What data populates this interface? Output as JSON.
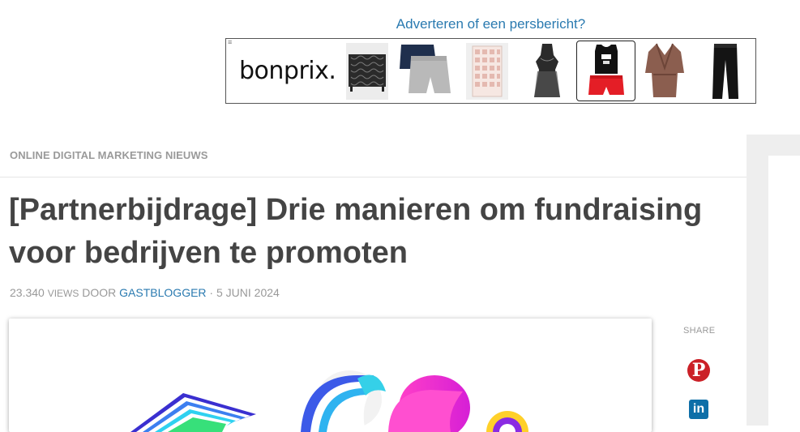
{
  "ad": {
    "link_text": "Adverteren of een persbericht?",
    "menu_icon": "menu-icon",
    "brand": "bonprix.",
    "products": [
      {
        "name": "black-cabinet"
      },
      {
        "name": "shorts"
      },
      {
        "name": "rack"
      },
      {
        "name": "lingerie"
      },
      {
        "name": "pajama-set"
      },
      {
        "name": "bathrobe"
      },
      {
        "name": "trousers"
      }
    ],
    "colors": {
      "link": "#2a7ab0"
    }
  },
  "article": {
    "category": "ONLINE DIGITAL MARKETING NIEUWS",
    "title": "[Partnerbijdrage] Drie manieren om fundraising voor bedrijven te promoten",
    "meta": {
      "views": "23.340",
      "views_label": "VIEWS",
      "by": "DOOR",
      "author": "GASTBLOGGER",
      "separator": "·",
      "date": "5 JUNI 2024"
    }
  },
  "share": {
    "label": "SHARE",
    "buttons": [
      {
        "icon": "pinterest-icon",
        "glyph": "P",
        "color": "#cb2027"
      },
      {
        "icon": "linkedin-icon",
        "glyph": "in",
        "color": "#0e6fa8"
      }
    ]
  }
}
